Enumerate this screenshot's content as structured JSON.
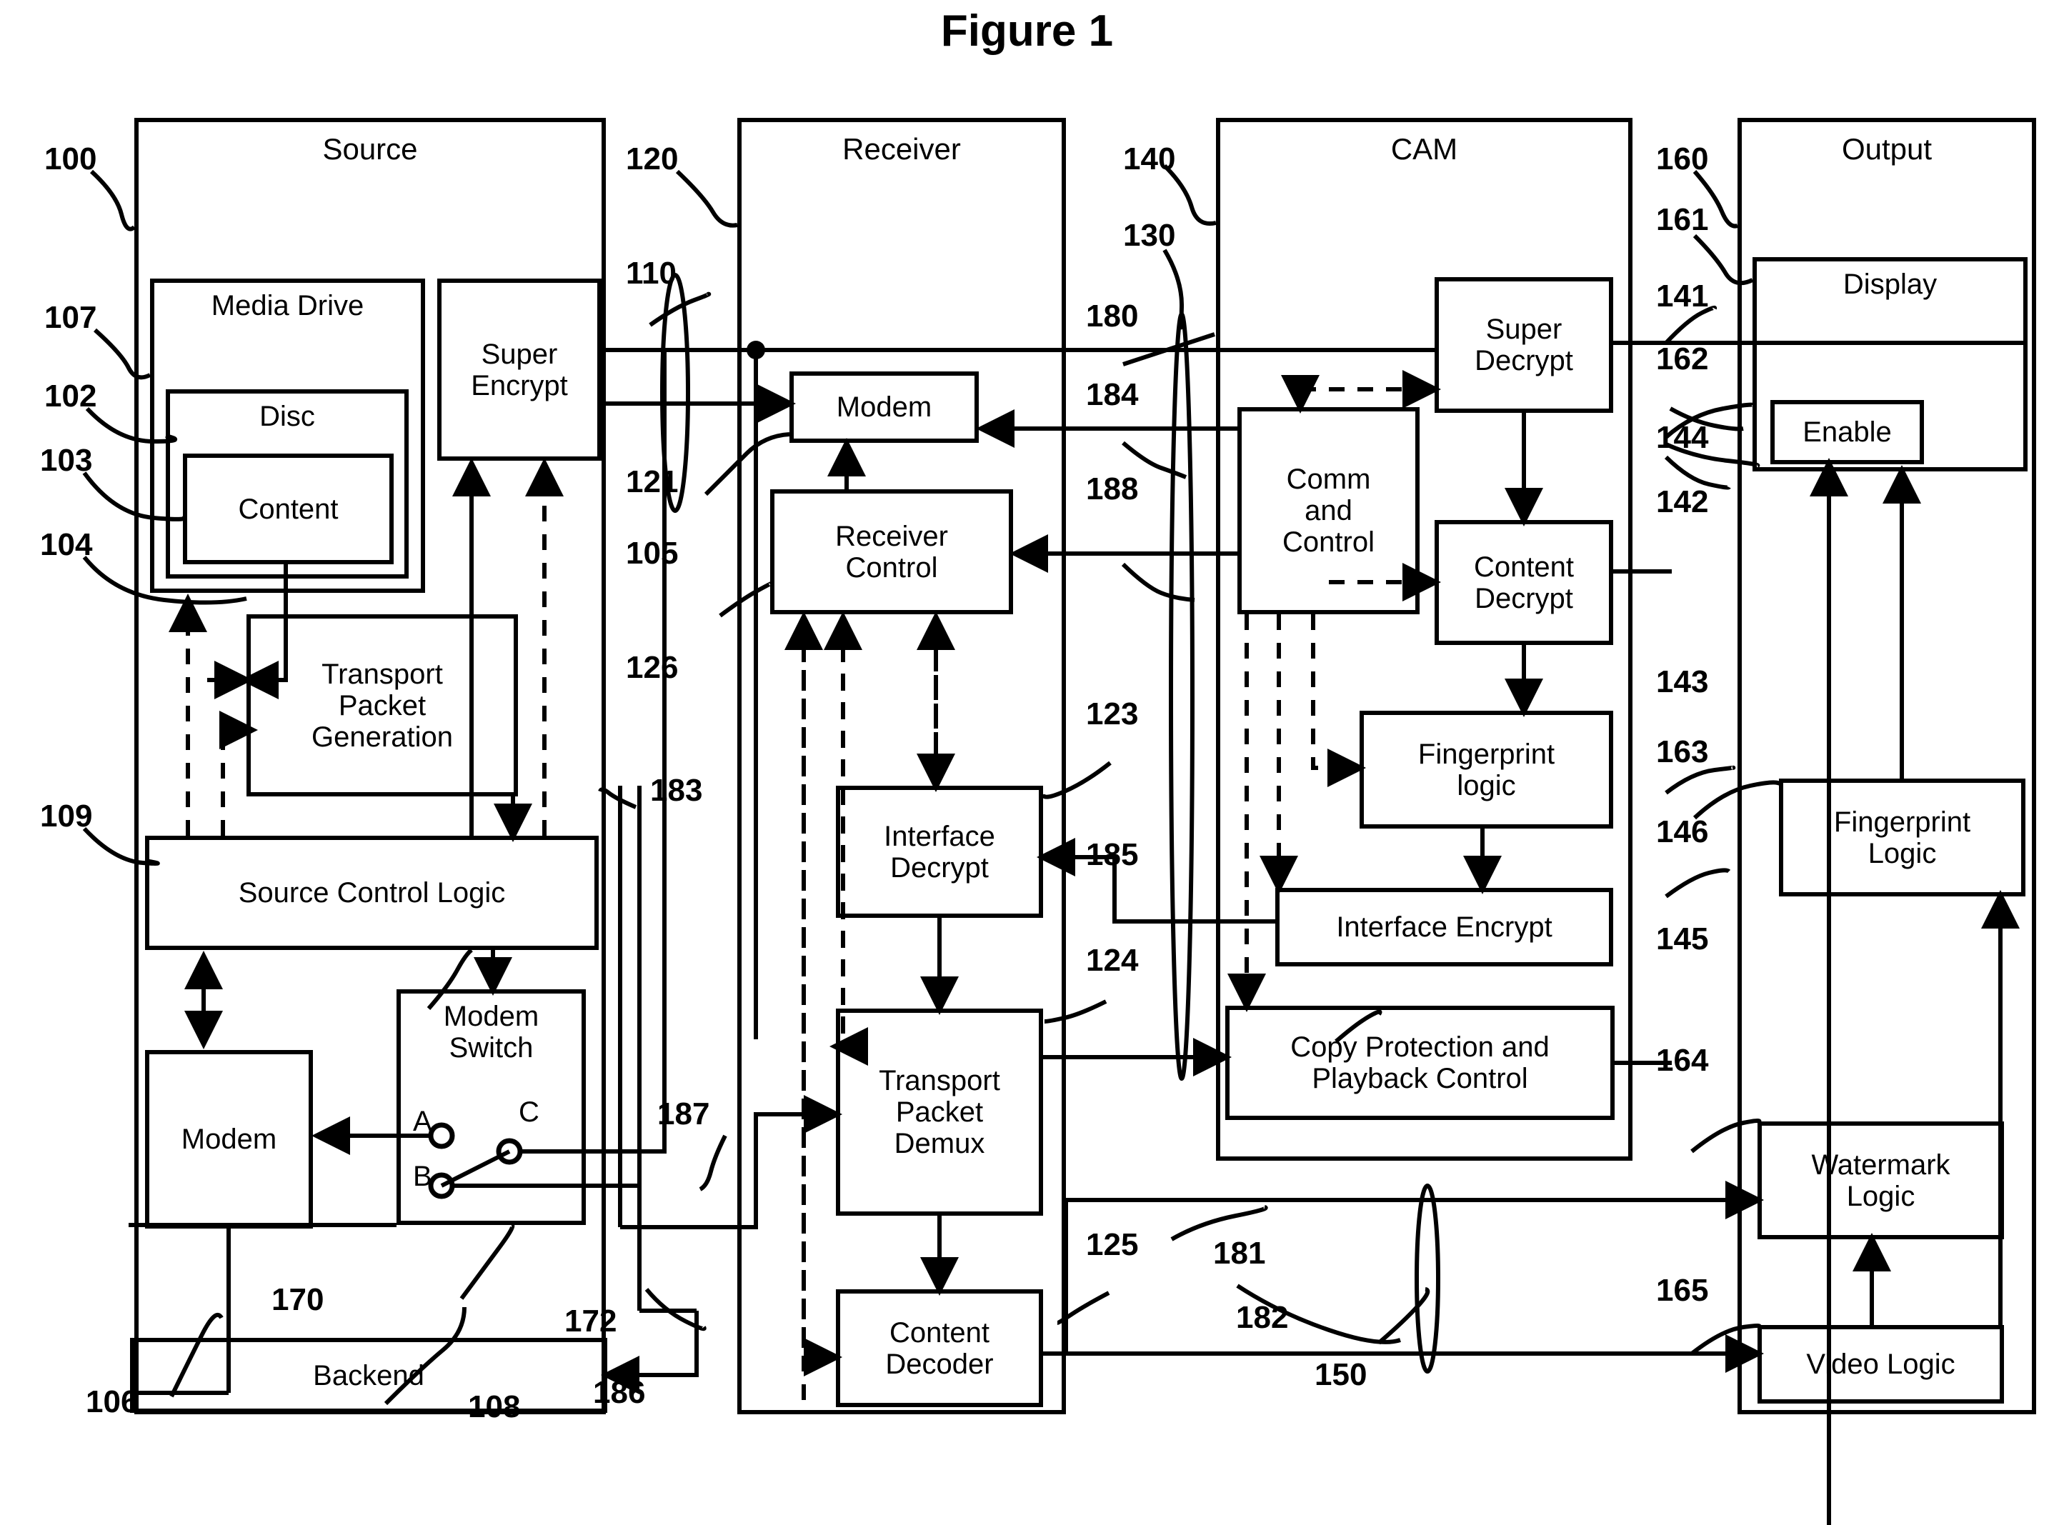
{
  "figure": {
    "title": "Figure 1"
  },
  "containers": [
    {
      "id": "source",
      "title": "Source"
    },
    {
      "id": "receiver",
      "title": "Receiver"
    },
    {
      "id": "cam",
      "title": "CAM"
    },
    {
      "id": "output",
      "title": "Output"
    }
  ],
  "blocks": {
    "media_drive": "Media Drive",
    "disc": "Disc",
    "content": "Content",
    "super_encrypt": "Super\nEncrypt",
    "transport_packet_generation": "Transport\nPacket\nGeneration",
    "source_control_logic": "Source Control Logic",
    "source_modem": "Modem",
    "modem_switch": "Modem\nSwitch",
    "backend": "Backend",
    "receiver_modem": "Modem",
    "receiver_control": "Receiver\nControl",
    "interface_decrypt": "Interface\nDecrypt",
    "transport_packet_demux": "Transport\nPacket\nDemux",
    "content_decoder": "Content\nDecoder",
    "comm_and_control": "Comm\nand\nControl",
    "super_decrypt": "Super\nDecrypt",
    "content_decrypt": "Content\nDecrypt",
    "fingerprint_logic_cam": "Fingerprint\nlogic",
    "interface_encrypt": "Interface Encrypt",
    "copy_protection": "Copy Protection and\nPlayback Control",
    "display": "Display",
    "enable": "Enable",
    "fingerprint_logic_out": "Fingerprint\nLogic",
    "watermark_logic": "Watermark\nLogic",
    "video_logic": "Video Logic"
  },
  "switch_terminals": {
    "a": "A",
    "b": "B",
    "c": "C"
  },
  "refs": {
    "r100": "100",
    "r102": "102",
    "r103": "103",
    "r104": "104",
    "r105": "105",
    "r106": "106",
    "r107": "107",
    "r108": "108",
    "r109": "109",
    "r110": "110",
    "r120": "120",
    "r121": "121",
    "r123": "123",
    "r124": "124",
    "r125": "125",
    "r126": "126",
    "r130": "130",
    "r140": "140",
    "r141": "141",
    "r142": "142",
    "r143": "143",
    "r144": "144",
    "r145": "145",
    "r146": "146",
    "r150": "150",
    "r160": "160",
    "r161": "161",
    "r162": "162",
    "r163": "163",
    "r164": "164",
    "r165": "165",
    "r170": "170",
    "r172": "172",
    "r180": "180",
    "r181": "181",
    "r182": "182",
    "r183": "183",
    "r184": "184",
    "r185": "185",
    "r186": "186",
    "r187": "187",
    "r188": "188"
  },
  "colors": {
    "ink": "#000000",
    "paper": "#ffffff"
  }
}
